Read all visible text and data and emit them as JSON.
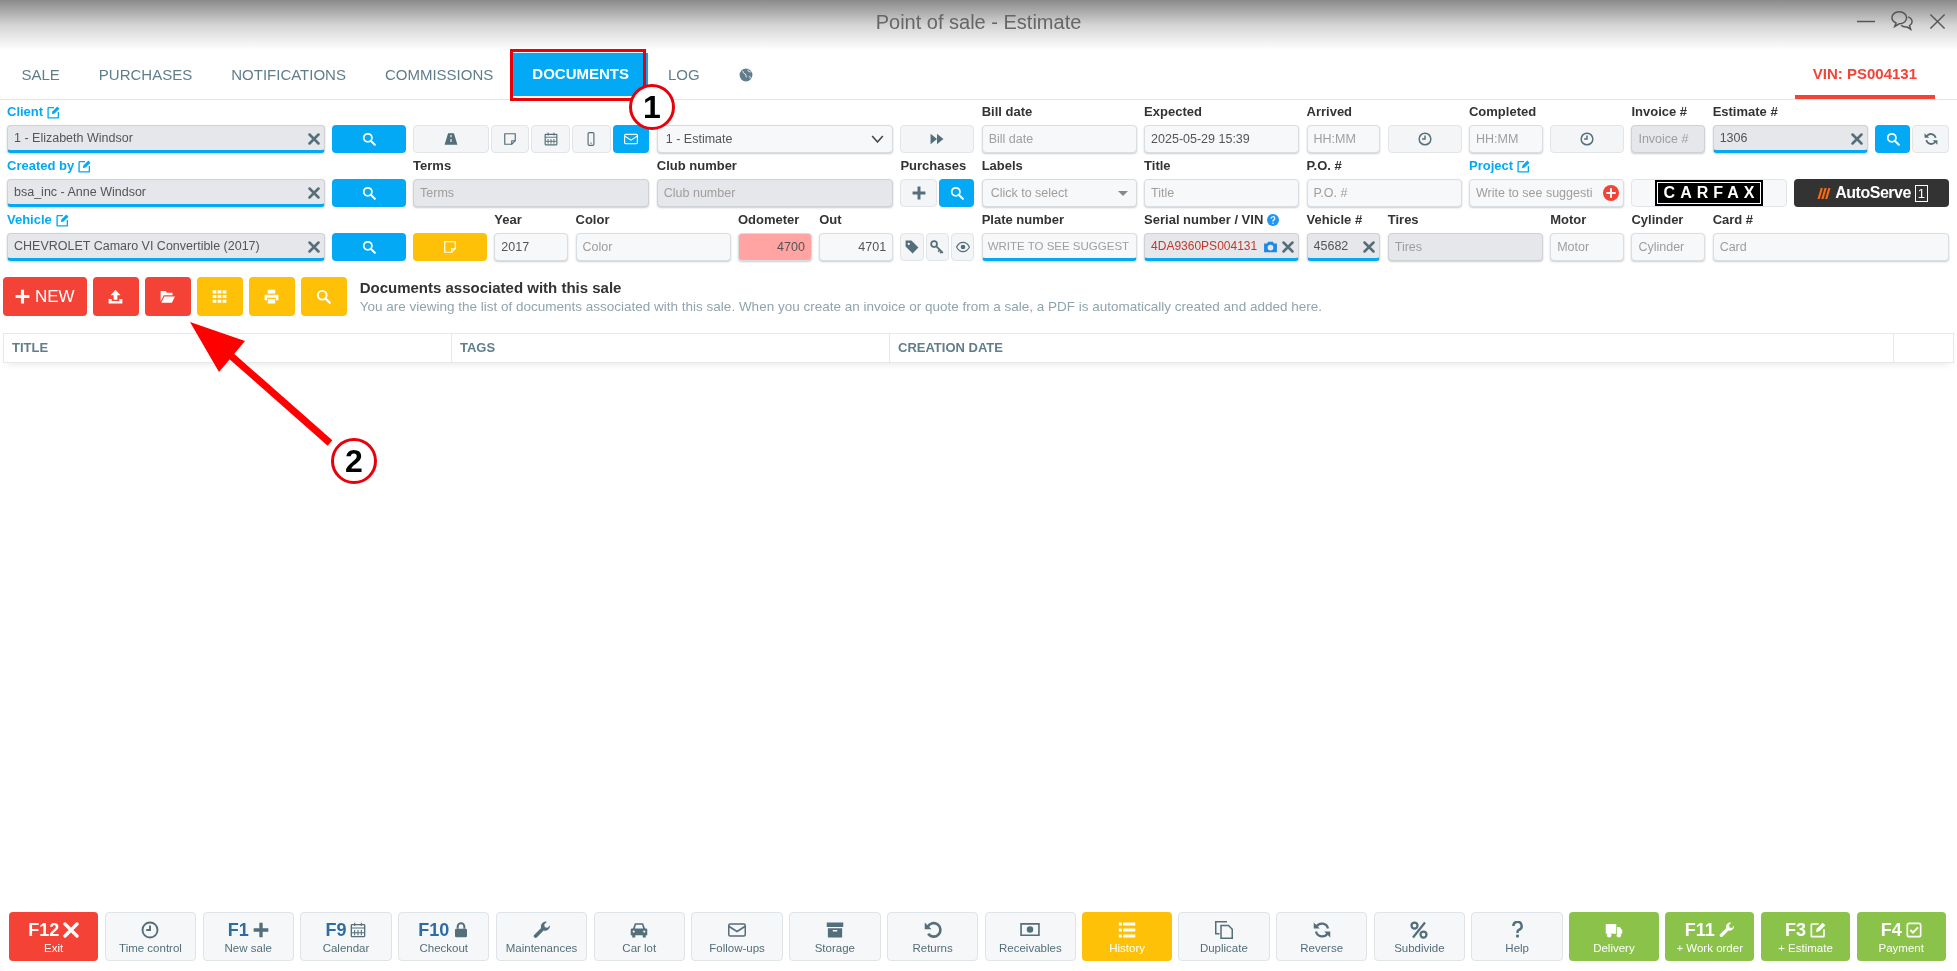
{
  "window": {
    "title": "Point of sale - Estimate"
  },
  "tabs": [
    {
      "kind": "text",
      "label": "SALE",
      "selected": false
    },
    {
      "kind": "text",
      "label": "PURCHASES",
      "selected": false
    },
    {
      "kind": "text",
      "label": "NOTIFICATIONS",
      "selected": false
    },
    {
      "kind": "text",
      "label": "COMMISSIONS",
      "selected": false
    },
    {
      "kind": "text",
      "label": "DOCUMENTS",
      "selected": true
    },
    {
      "kind": "text",
      "label": "LOG",
      "selected": false
    },
    {
      "kind": "icon",
      "selected": false
    }
  ],
  "vin_tab": {
    "label": "VIN: PS004131"
  },
  "form": {
    "fields": [
      {
        "kind": "input",
        "label": "Client",
        "label_link": true,
        "value": "1 - Elizabeth Windsor",
        "disabled": true,
        "clearable": true,
        "underlined": true,
        "alert": false
      },
      {
        "kind": "button",
        "color": "#03a9f4"
      },
      {
        "kind": "button-group",
        "buttons": [
          {
            "color": "#f3f5f7"
          },
          {
            "color": "#f3f5f7"
          },
          {
            "color": "#f3f5f7"
          },
          {
            "color": "#f3f5f7"
          },
          {
            "color": "#03a9f4"
          }
        ]
      },
      {
        "kind": "select",
        "value": "1 - Estimate"
      },
      {
        "kind": "button",
        "color": "#f3f5f7"
      },
      {
        "kind": "input",
        "label": "Bill date",
        "label_link": false,
        "placeholder": "Bill date",
        "disabled": false,
        "clearable": false,
        "underlined": false,
        "alert": false
      },
      {
        "kind": "input",
        "label": "Expected",
        "label_link": false,
        "value": "2025-05-29 15:39",
        "disabled": false,
        "clearable": false,
        "underlined": false,
        "alert": false
      },
      {
        "kind": "input",
        "label": "Arrived",
        "label_link": false,
        "placeholder": "HH:MM",
        "disabled": false,
        "clearable": false,
        "underlined": false,
        "alert": false
      },
      {
        "kind": "button",
        "color": "#f3f5f7"
      },
      {
        "kind": "input",
        "label": "Completed",
        "label_link": false,
        "placeholder": "HH:MM",
        "disabled": false,
        "clearable": false,
        "underlined": false,
        "alert": false
      },
      {
        "kind": "button",
        "color": "#f3f5f7"
      },
      {
        "kind": "input",
        "label": "Invoice #",
        "label_link": false,
        "placeholder": "Invoice #",
        "disabled": true,
        "clearable": false,
        "underlined": false,
        "alert": false
      },
      {
        "kind": "input",
        "label": "Estimate #",
        "label_link": false,
        "value": "1306",
        "disabled": true,
        "clearable": true,
        "underlined": true,
        "alert": false
      },
      {
        "kind": "button-group",
        "buttons": [
          {
            "color": "#03a9f4"
          },
          {
            "color": "#f3f5f7"
          }
        ]
      },
      {
        "kind": "input",
        "label": "Created by",
        "label_link": true,
        "value": "bsa_inc - Anne Windsor",
        "disabled": true,
        "clearable": true,
        "underlined": true,
        "alert": false
      },
      {
        "kind": "button",
        "color": "#03a9f4"
      },
      {
        "kind": "input",
        "label": "Terms",
        "label_link": false,
        "placeholder": "Terms",
        "disabled": true,
        "clearable": false,
        "underlined": false,
        "alert": false
      },
      {
        "kind": "input",
        "label": "Club number",
        "label_link": false,
        "placeholder": "Club number",
        "disabled": true,
        "clearable": false,
        "underlined": false,
        "alert": false
      },
      {
        "kind": "button-group",
        "label": "Purchases",
        "buttons": [
          {
            "color": "#f3f5f7"
          },
          {
            "color": "#03a9f4"
          }
        ]
      },
      {
        "kind": "select",
        "label": "Labels",
        "placeholder": "Click to select"
      },
      {
        "kind": "input",
        "label": "Title",
        "label_link": false,
        "placeholder": "Title",
        "disabled": false,
        "clearable": false,
        "underlined": false,
        "alert": false
      },
      {
        "kind": "input",
        "label": "P.O. #",
        "label_link": false,
        "placeholder": "P.O. #",
        "disabled": false,
        "clearable": false,
        "underlined": false,
        "alert": false
      },
      {
        "kind": "input",
        "label": "Project",
        "label_link": true,
        "placeholder": "Write to see suggesti",
        "disabled": false,
        "clearable": false,
        "underlined": false,
        "alert": false
      },
      {
        "kind": "logo",
        "text": "CARFAX"
      },
      {
        "kind": "logo",
        "text": "AutoServe",
        "badge": "1"
      },
      {
        "kind": "input",
        "label": "Vehicle",
        "label_link": true,
        "value": "CHEVROLET Camaro VI Convertible (2017)",
        "disabled": true,
        "clearable": true,
        "underlined": true,
        "alert": false
      },
      {
        "kind": "button",
        "color": "#03a9f4"
      },
      {
        "kind": "button",
        "color": "#ffc107"
      },
      {
        "kind": "input",
        "label": "Year",
        "label_link": false,
        "value": "2017",
        "disabled": false,
        "clearable": false,
        "underlined": false,
        "alert": false
      },
      {
        "kind": "input",
        "label": "Color",
        "label_link": false,
        "placeholder": "Color",
        "disabled": false,
        "clearable": false,
        "underlined": false,
        "alert": false
      },
      {
        "kind": "number",
        "label": "Odometer",
        "label_link": false,
        "value": "4700",
        "disabled": false,
        "clearable": false,
        "underlined": false,
        "alert": true
      },
      {
        "kind": "number",
        "label": "Out",
        "label_link": false,
        "value": "4701",
        "disabled": false,
        "clearable": false,
        "underlined": false,
        "alert": false
      },
      {
        "kind": "button-group",
        "buttons": [
          {
            "color": "#f3f5f7"
          },
          {
            "color": "#f3f5f7"
          },
          {
            "color": "#f3f5f7"
          }
        ]
      },
      {
        "kind": "input",
        "label": "Plate number",
        "label_link": false,
        "placeholder": "WRITE TO SEE SUGGEST",
        "disabled": false,
        "clearable": false,
        "underlined": true,
        "alert": false
      },
      {
        "kind": "input",
        "label": "Serial number / VIN",
        "label_link": false,
        "value": "4DA9360PS004131",
        "disabled": true,
        "clearable": true,
        "underlined": true,
        "alert": true
      },
      {
        "kind": "input",
        "label": "Vehicle #",
        "label_link": false,
        "value": "45682",
        "disabled": true,
        "clearable": true,
        "underlined": true,
        "alert": false
      },
      {
        "kind": "input",
        "label": "Tires",
        "label_link": false,
        "placeholder": "Tires",
        "disabled": true,
        "clearable": false,
        "underlined": false,
        "alert": false
      },
      {
        "kind": "input",
        "label": "Motor",
        "label_link": false,
        "placeholder": "Motor",
        "disabled": false,
        "clearable": false,
        "underlined": false,
        "alert": false
      },
      {
        "kind": "input",
        "label": "Cylinder",
        "label_link": false,
        "placeholder": "Cylinder",
        "disabled": false,
        "clearable": false,
        "underlined": false,
        "alert": false
      },
      {
        "kind": "input",
        "label": "Card #",
        "label_link": false,
        "placeholder": "Card",
        "disabled": false,
        "clearable": false,
        "underlined": false,
        "alert": false
      }
    ]
  },
  "actions": [
    {
      "label": "NEW",
      "color": "#f44336"
    },
    {
      "color": "#f44336"
    },
    {
      "color": "#f44336"
    },
    {
      "color": "#ffc107"
    },
    {
      "color": "#ffc107"
    },
    {
      "color": "#ffc107"
    }
  ],
  "section": {
    "title": "Documents associated with this sale",
    "description": "You are viewing the list of documents associated with this sale. When you create an invoice or quote from a sale, a PDF is automatically created and added here."
  },
  "table": {
    "columns": [
      "TITLE",
      "TAGS",
      "CREATION DATE"
    ]
  },
  "bottom_bar": [
    {
      "key": "F12",
      "label": "Exit",
      "color": "#f44336"
    },
    {
      "label": "Time control",
      "color": "#f5f7f9"
    },
    {
      "key": "F1",
      "label": "New sale",
      "color": "#f5f7f9"
    },
    {
      "key": "F9",
      "label": "Calendar",
      "color": "#f5f7f9"
    },
    {
      "key": "F10",
      "label": "Checkout",
      "color": "#f5f7f9"
    },
    {
      "label": "Maintenances",
      "color": "#f5f7f9"
    },
    {
      "label": "Car lot",
      "color": "#f5f7f9"
    },
    {
      "label": "Follow-ups",
      "color": "#f5f7f9"
    },
    {
      "label": "Storage",
      "color": "#f5f7f9"
    },
    {
      "label": "Returns",
      "color": "#f5f7f9"
    },
    {
      "label": "Receivables",
      "color": "#f5f7f9"
    },
    {
      "label": "History",
      "color": "#ffc107"
    },
    {
      "label": "Duplicate",
      "color": "#f5f7f9"
    },
    {
      "label": "Reverse",
      "color": "#f5f7f9"
    },
    {
      "label": "Subdivide",
      "color": "#f5f7f9"
    },
    {
      "label": "Help",
      "color": "#f5f7f9"
    },
    {
      "label": "Delivery",
      "color": "#8bc34a"
    },
    {
      "key": "F11",
      "label": "+ Work order",
      "color": "#8bc34a"
    },
    {
      "key": "F3",
      "label": "+ Estimate",
      "color": "#8bc34a"
    },
    {
      "key": "F4",
      "label": "Payment",
      "color": "#8bc34a"
    }
  ],
  "annotations": [
    {
      "kind": "frame"
    },
    {
      "kind": "badge",
      "text": "1"
    },
    {
      "kind": "arrow"
    },
    {
      "kind": "badge",
      "text": "2"
    }
  ]
}
